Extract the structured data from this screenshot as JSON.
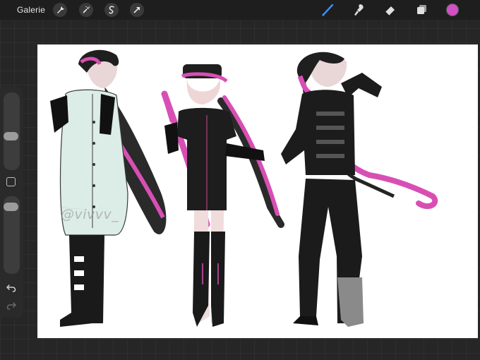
{
  "topbar": {
    "gallery_label": "Galerie",
    "left_tools": [
      {
        "name": "wrench-icon"
      },
      {
        "name": "magic-wand-icon"
      },
      {
        "name": "selection-icon"
      },
      {
        "name": "move-arrow-icon"
      }
    ],
    "right_tools": [
      {
        "name": "brush-icon",
        "active": true
      },
      {
        "name": "smudge-icon"
      },
      {
        "name": "eraser-icon"
      },
      {
        "name": "layers-icon"
      }
    ],
    "current_color": "#d24fc4",
    "accent_color": "#3b8ff0"
  },
  "sidebar": {
    "brush_size_level": 0.42,
    "opacity_level": 0.95,
    "icons": [
      "modifier-square-icon",
      "undo-icon",
      "redo-icon"
    ]
  },
  "canvas": {
    "watermark": "@vivvv_"
  }
}
